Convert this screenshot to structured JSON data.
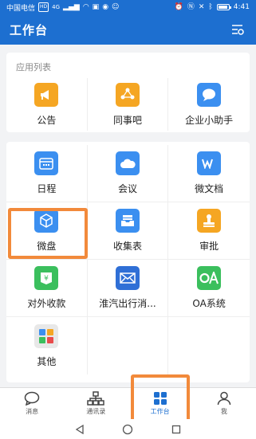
{
  "status_bar": {
    "carrier": "中国电信",
    "network": "4G",
    "time": "4:41",
    "battery_level": 0.75
  },
  "header": {
    "title": "工作台",
    "settings_icon": "filter-settings-icon"
  },
  "section1": {
    "title": "应用列表",
    "items": [
      {
        "label": "公告",
        "icon": "megaphone-icon",
        "color": "#f5a623"
      },
      {
        "label": "同事吧",
        "icon": "share-icon",
        "color": "#f5a623"
      },
      {
        "label": "企业小助手",
        "icon": "chat-bubble-icon",
        "color": "#3b8ff0"
      }
    ]
  },
  "section2": {
    "items": [
      {
        "label": "日程",
        "icon": "calendar-icon",
        "color": "#3b8ff0"
      },
      {
        "label": "会议",
        "icon": "cloud-icon",
        "color": "#3b8ff0"
      },
      {
        "label": "微文档",
        "icon": "word-doc-icon",
        "color": "#3b8ff0"
      },
      {
        "label": "微盘",
        "icon": "cube-box-icon",
        "color": "#3b8ff0"
      },
      {
        "label": "收集表",
        "icon": "form-tray-icon",
        "color": "#3b8ff0"
      },
      {
        "label": "审批",
        "icon": "stamp-icon",
        "color": "#f5a623"
      },
      {
        "label": "对外收款",
        "icon": "yuan-wallet-icon",
        "color": "#3bbf5d"
      },
      {
        "label": "淮汽出行消...",
        "icon": "envelope-icon",
        "color": "#2f6fd6"
      },
      {
        "label": "OA系统",
        "icon": "oa-logo-icon",
        "color": "#3bbf5d"
      },
      {
        "label": "其他",
        "icon": "app-grid-icon",
        "color": "#e8e8e8"
      }
    ]
  },
  "tabbar": {
    "tabs": [
      {
        "label": "消息",
        "icon": "message-icon"
      },
      {
        "label": "通讯录",
        "icon": "contacts-tree-icon"
      },
      {
        "label": "工作台",
        "icon": "workbench-grid-icon",
        "active": true
      },
      {
        "label": "我",
        "icon": "person-icon"
      }
    ]
  },
  "highlight_color": "#f28a3b"
}
